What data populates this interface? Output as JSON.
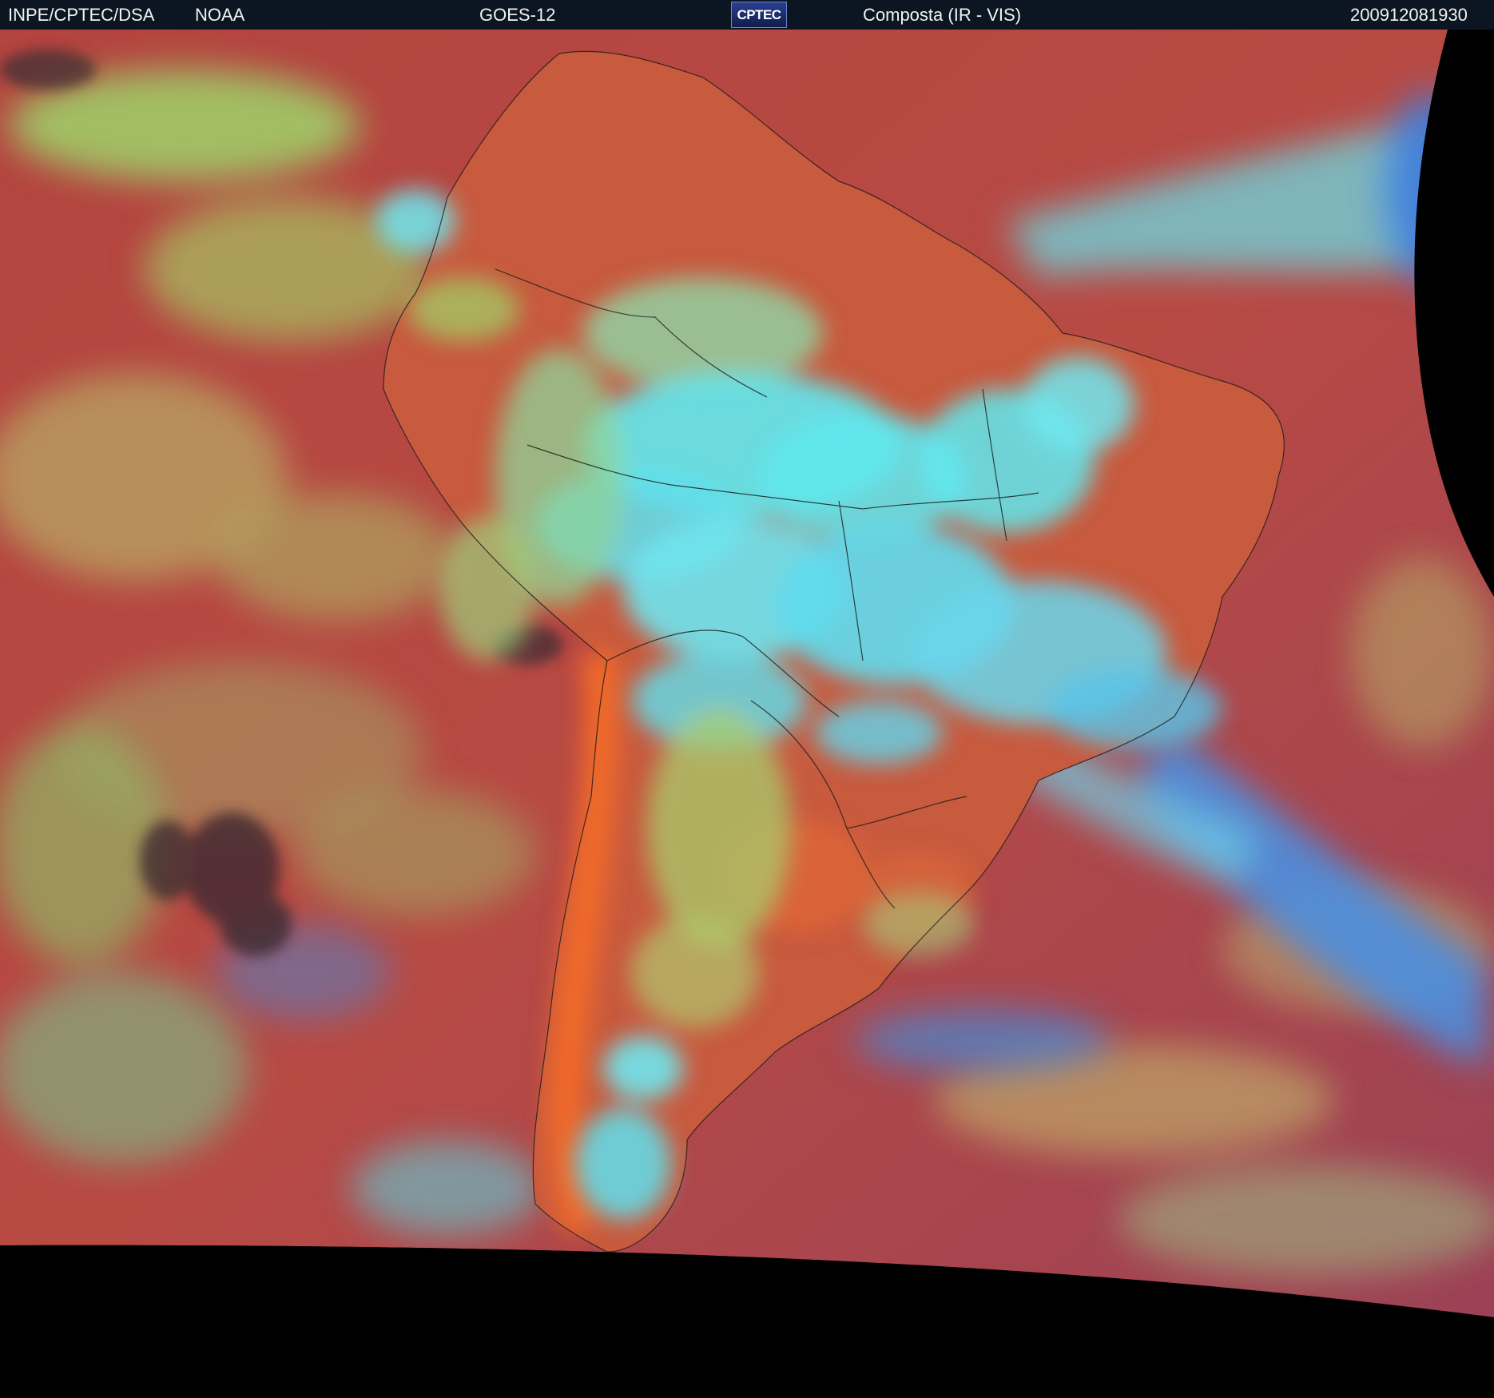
{
  "header": {
    "agency": "INPE/CPTEC/DSA",
    "source": "NOAA",
    "satellite": "GOES-12",
    "logo_text": "CPTEC",
    "product": "Composta (IR - VIS)",
    "timestamp": "200912081930"
  },
  "colors": {
    "header_bg": "#0b1622",
    "ocean_red": "#b84a44",
    "cloud_cyan": "#5fe9f0",
    "cloud_green": "#9fd46a",
    "cloud_blue": "#4a8fe0",
    "land_orange": "#e8662a",
    "border_line": "#1a1a1a",
    "off_earth": "#000000"
  }
}
